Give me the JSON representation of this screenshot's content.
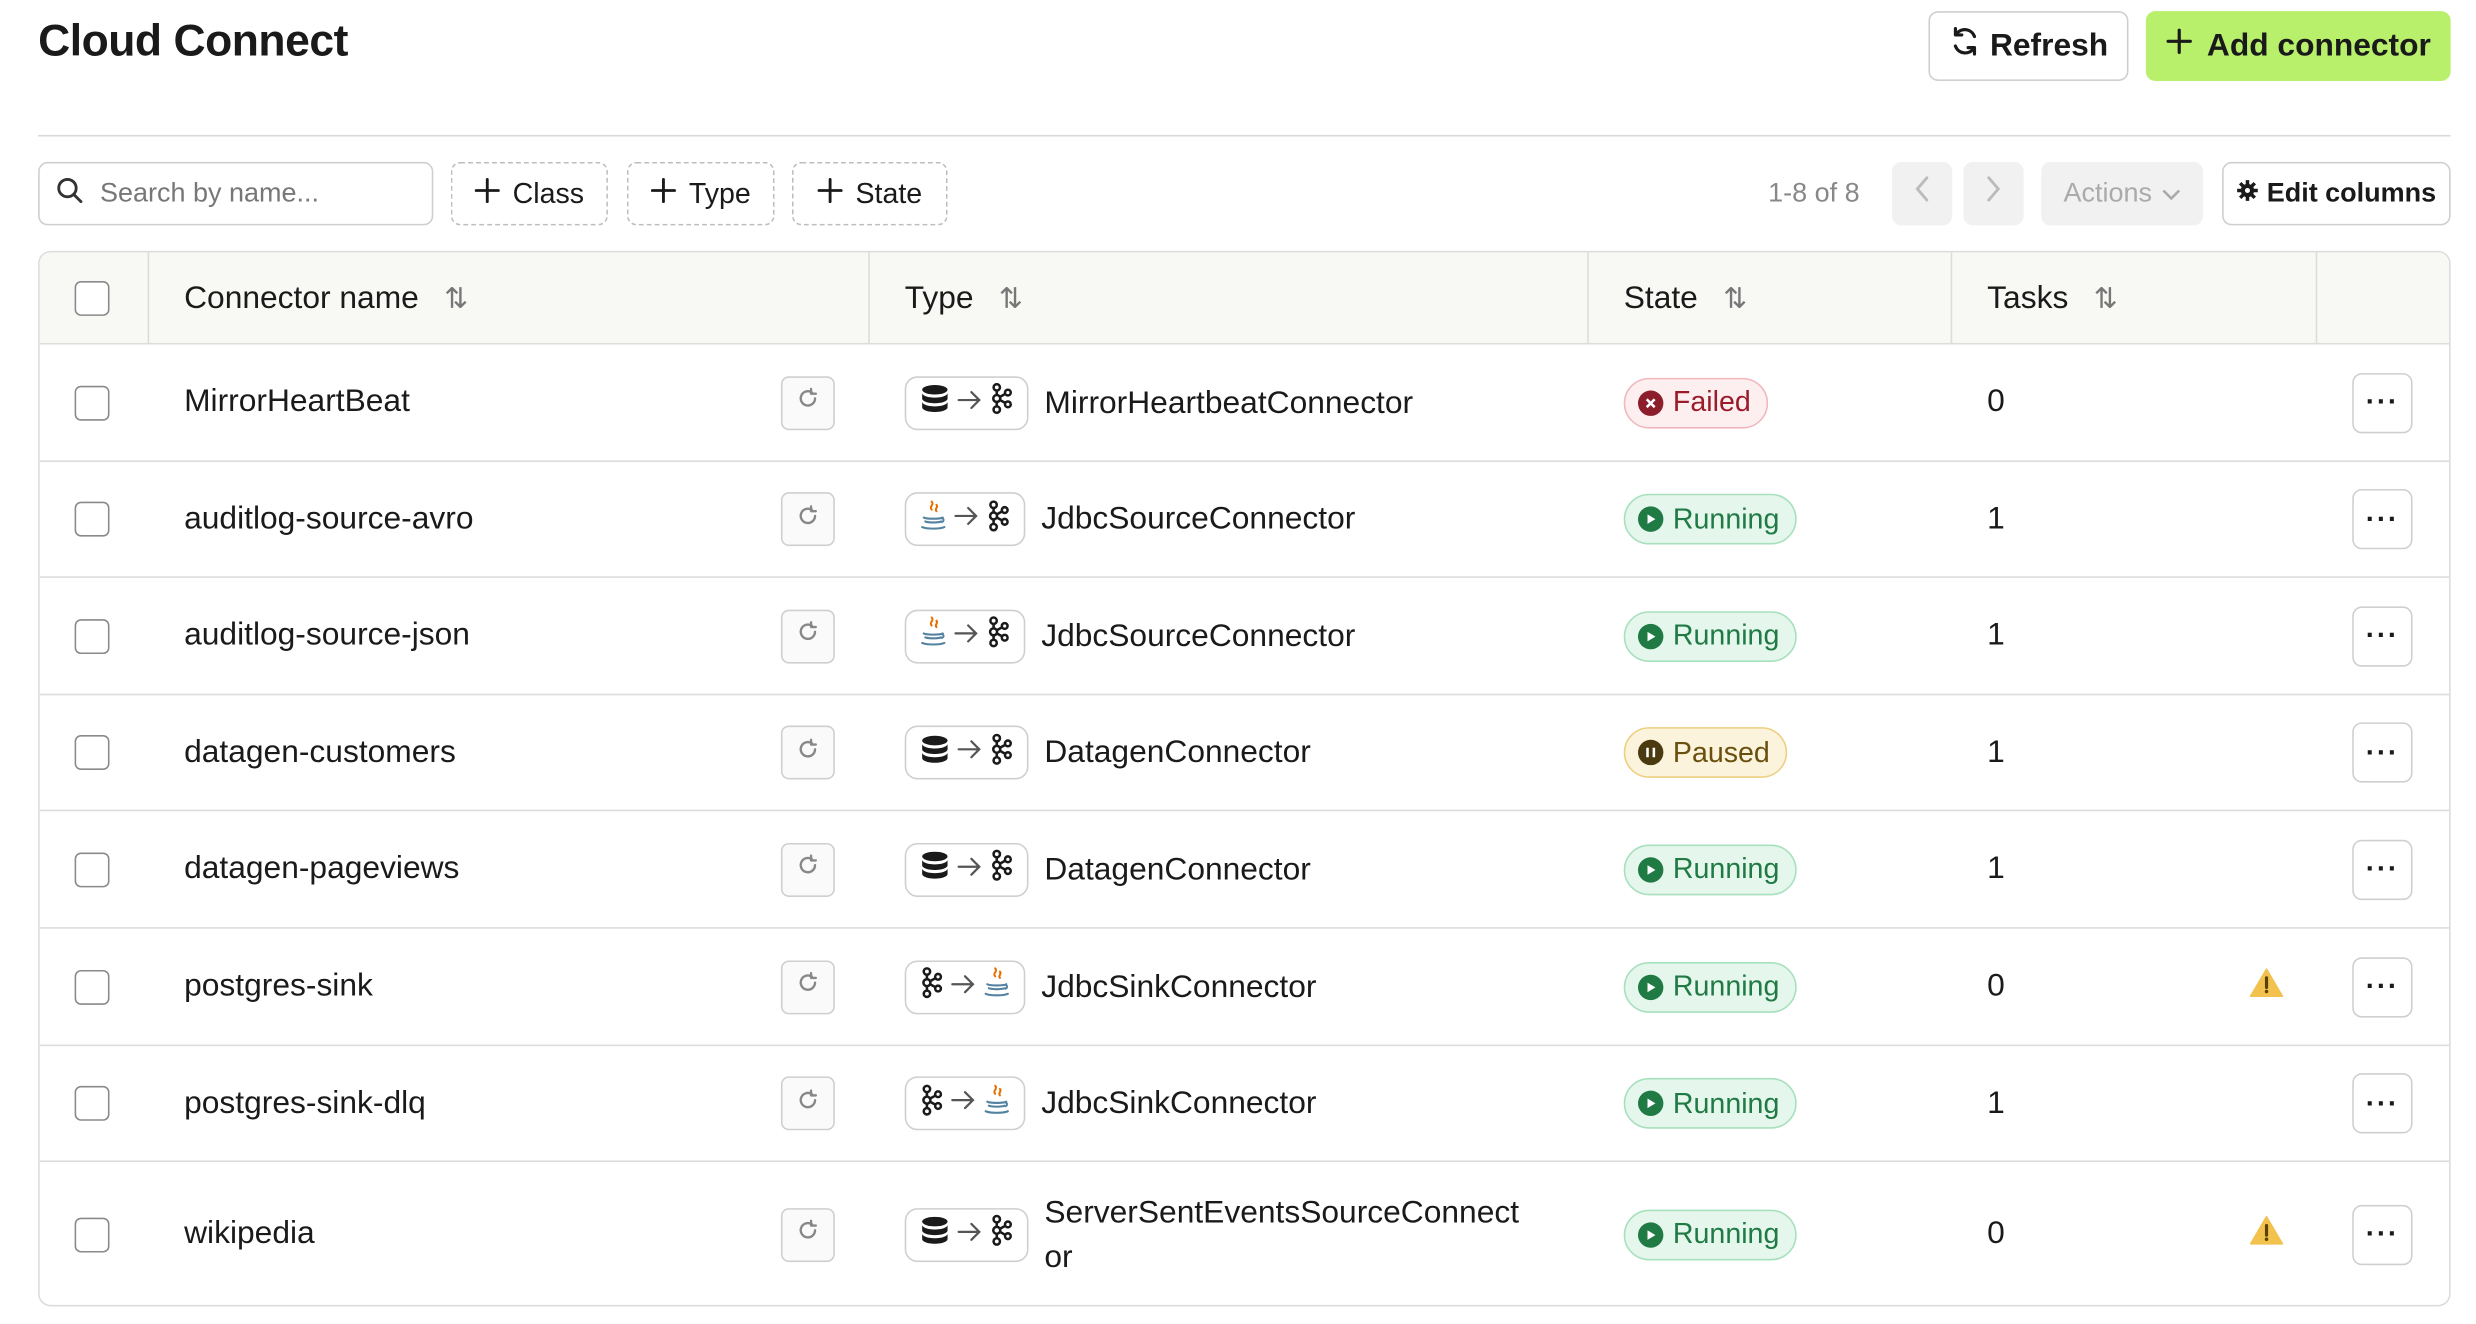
{
  "header": {
    "title": "Cloud Connect",
    "refresh_label": "Refresh",
    "add_label": "Add connector",
    "accent": "#b8f06c"
  },
  "toolbar": {
    "search_placeholder": "Search by name...",
    "filters": [
      "Class",
      "Type",
      "State"
    ],
    "pagination": "1-8 of 8",
    "actions_label": "Actions",
    "edit_columns_label": "Edit columns"
  },
  "table": {
    "columns": [
      "Connector name",
      "Type",
      "State",
      "Tasks"
    ],
    "rows": [
      {
        "name": "MirrorHeartBeat",
        "flow_from": "database-icon",
        "flow_to": "kafka-icon",
        "type": "MirrorHeartbeatConnector",
        "state": "Failed",
        "tasks": "0",
        "warning": false
      },
      {
        "name": "auditlog-source-avro",
        "flow_from": "java-icon",
        "flow_to": "kafka-icon",
        "type": "JdbcSourceConnector",
        "state": "Running",
        "tasks": "1",
        "warning": false
      },
      {
        "name": "auditlog-source-json",
        "flow_from": "java-icon",
        "flow_to": "kafka-icon",
        "type": "JdbcSourceConnector",
        "state": "Running",
        "tasks": "1",
        "warning": false
      },
      {
        "name": "datagen-customers",
        "flow_from": "database-icon",
        "flow_to": "kafka-icon",
        "type": "DatagenConnector",
        "state": "Paused",
        "tasks": "1",
        "warning": false
      },
      {
        "name": "datagen-pageviews",
        "flow_from": "database-icon",
        "flow_to": "kafka-icon",
        "type": "DatagenConnector",
        "state": "Running",
        "tasks": "1",
        "warning": false
      },
      {
        "name": "postgres-sink",
        "flow_from": "kafka-icon",
        "flow_to": "java-icon",
        "type": "JdbcSinkConnector",
        "state": "Running",
        "tasks": "0",
        "warning": true
      },
      {
        "name": "postgres-sink-dlq",
        "flow_from": "kafka-icon",
        "flow_to": "java-icon",
        "type": "JdbcSinkConnector",
        "state": "Running",
        "tasks": "1",
        "warning": false
      },
      {
        "name": "wikipedia",
        "flow_from": "database-icon",
        "flow_to": "kafka-icon",
        "type": "ServerSentEventsSourceConnect or",
        "state": "Running",
        "tasks": "0",
        "warning": true
      }
    ]
  }
}
